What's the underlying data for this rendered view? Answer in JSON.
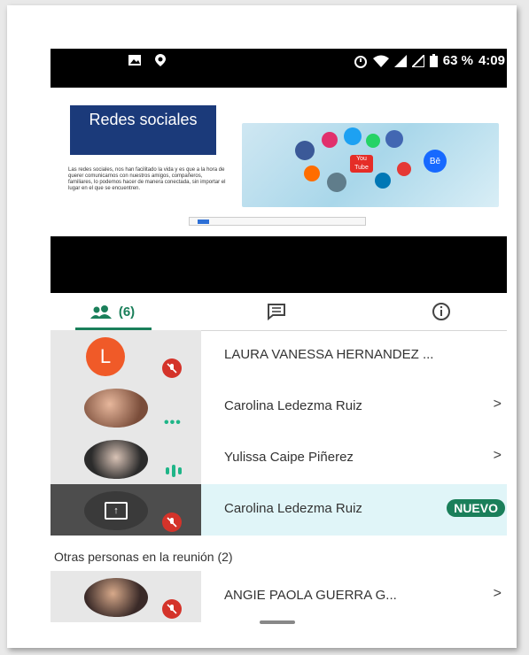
{
  "status_bar": {
    "battery": "63 %",
    "time": "4:09"
  },
  "slide": {
    "title": "Redes sociales",
    "text": "Las redes sociales, nos han facilitado la vida y es que a la hora de querer comunicarnos con nuestros amigos, compañeros, familiares, lo podemos hacer de manera conectada, sin importar el lugar en el que se encuentren.",
    "image_labels": [
      "You Tube",
      "Bē"
    ]
  },
  "tabs": {
    "people_count": "(6)"
  },
  "participants": [
    {
      "initial": "L",
      "name": "LAURA VANESSA HERNANDEZ ...",
      "status": "muted",
      "chevron": ""
    },
    {
      "name": "Carolina Ledezma Ruiz",
      "status": "dots",
      "chevron": ">"
    },
    {
      "name": "Yulissa Caipe Piñerez",
      "status": "speaking",
      "chevron": ">"
    },
    {
      "name": "Carolina Ledezma Ruiz",
      "status": "presenting",
      "badge": "NUEVO"
    }
  ],
  "others": {
    "title": "Otras personas en la reunión (2)",
    "items": [
      {
        "name": "ANGIE PAOLA GUERRA G...",
        "chevron": ">"
      }
    ]
  }
}
